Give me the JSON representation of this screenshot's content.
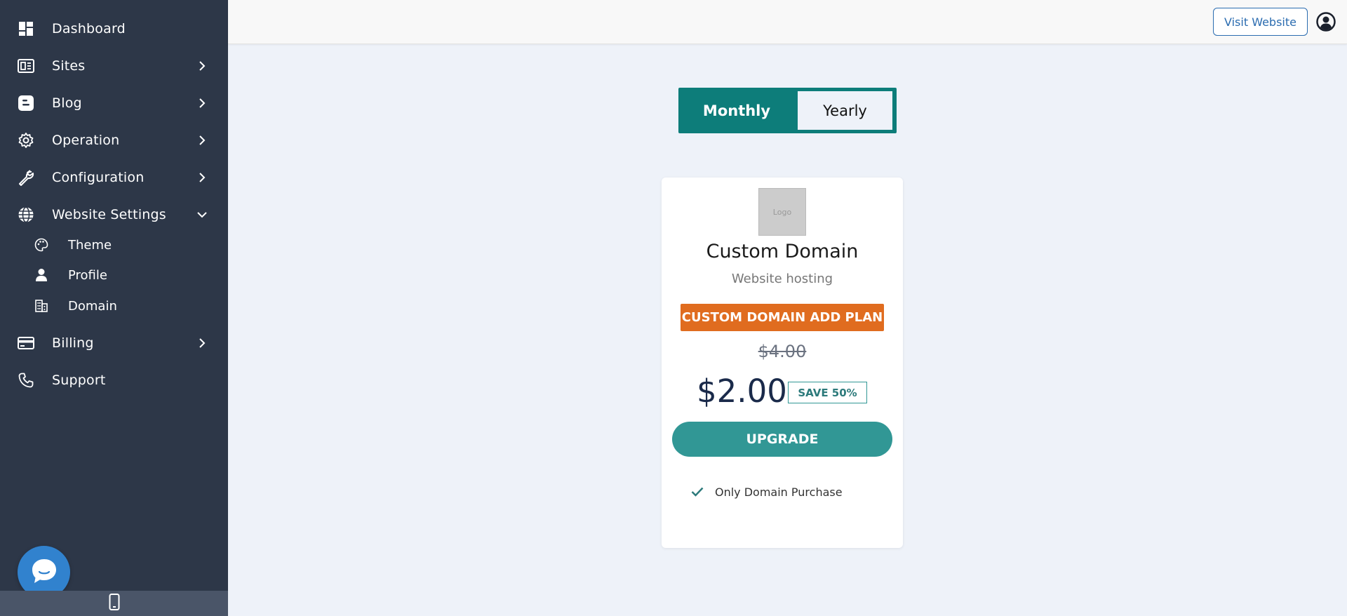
{
  "sidebar": {
    "items": [
      {
        "label": "Dashboard",
        "icon": "dashboard-icon"
      },
      {
        "label": "Sites",
        "icon": "sites-icon"
      },
      {
        "label": "Blog",
        "icon": "blog-icon"
      },
      {
        "label": "Operation",
        "icon": "gear-icon"
      },
      {
        "label": "Configuration",
        "icon": "wrench-icon"
      },
      {
        "label": "Website Settings",
        "icon": "globe-icon"
      },
      {
        "label": "Billing",
        "icon": "credit-card-icon"
      },
      {
        "label": "Support",
        "icon": "phone-icon"
      }
    ],
    "subitems": [
      {
        "label": "Theme",
        "icon": "palette-icon"
      },
      {
        "label": "Profile",
        "icon": "user-icon"
      },
      {
        "label": "Domain",
        "icon": "building-icon"
      }
    ]
  },
  "header": {
    "visit_label": "Visit Website"
  },
  "toggle": {
    "monthly": "Monthly",
    "yearly": "Yearly",
    "selected": "Monthly"
  },
  "plan": {
    "logo_text": "Logo",
    "title": "Custom Domain",
    "subtitle": "Website hosting",
    "badge": "CUSTOM DOMAIN ADD PLAN",
    "old_price": "$4.00",
    "price": "$2.00",
    "save": "SAVE 50%",
    "cta": "UPGRADE",
    "features": [
      "Only Domain Purchase"
    ]
  },
  "colors": {
    "sidebar_bg": "#2d3748",
    "accent_teal": "#319795",
    "toggle_teal": "#0d7d7a",
    "badge_orange": "#e06c1f",
    "link_blue": "#2b6cb0"
  }
}
